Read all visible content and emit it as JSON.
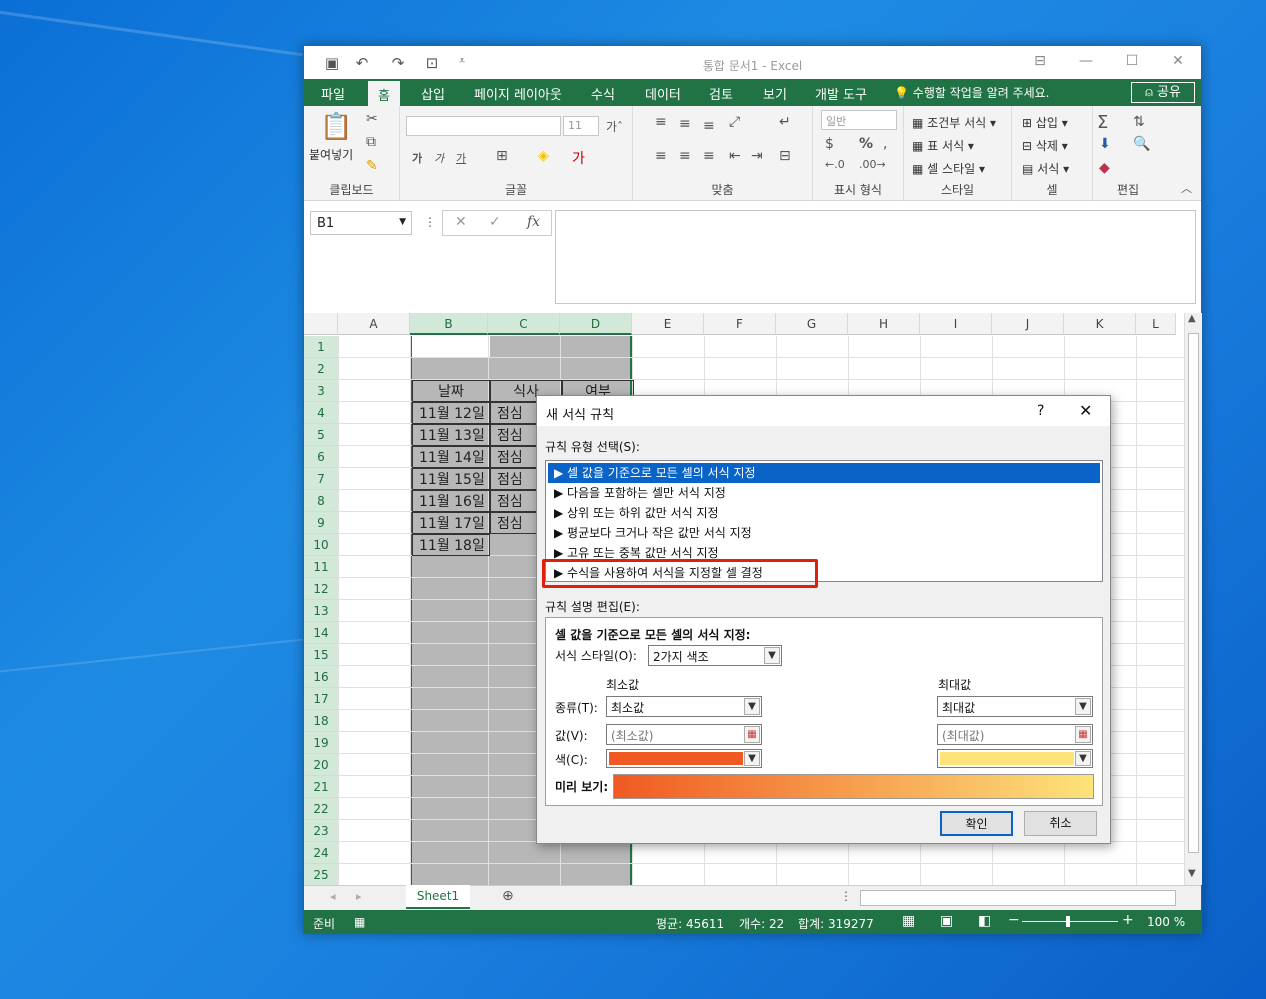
{
  "window": {
    "title": "통합 문서1 - Excel"
  },
  "tabs": [
    "파일",
    "홈",
    "삽입",
    "페이지 레이아웃",
    "수식",
    "데이터",
    "검토",
    "보기",
    "개발 도구"
  ],
  "tellme": "수행할 작업을 알려 주세요.",
  "share": "공유",
  "ribbon": {
    "clipboard": {
      "label": "클립보드",
      "paste": "붙여넣기"
    },
    "font": {
      "label": "글꼴",
      "size": "11"
    },
    "align": {
      "label": "맞춤"
    },
    "number": {
      "label": "표시 형식",
      "format": "일반"
    },
    "styles": {
      "label": "스타일",
      "cond": "조건부 서식",
      "table": "표 서식",
      "cell": "셀 스타일"
    },
    "cells": {
      "label": "셀",
      "insert": "삽입",
      "delete": "삭제",
      "format": "서식"
    },
    "edit": {
      "label": "편집"
    }
  },
  "namebox": "B1",
  "fx": "fx",
  "columns": [
    "A",
    "B",
    "C",
    "D",
    "E",
    "F",
    "G",
    "H",
    "I",
    "J",
    "K",
    "L"
  ],
  "rows": [
    "1",
    "2",
    "3",
    "4",
    "5",
    "6",
    "7",
    "8",
    "9",
    "10",
    "11",
    "12",
    "13",
    "14",
    "15",
    "16",
    "17",
    "18",
    "19",
    "20",
    "21",
    "22",
    "23",
    "24",
    "25"
  ],
  "table": {
    "headers": [
      "날짜",
      "식사",
      "여부"
    ],
    "dates": [
      "11월 12일",
      "11월 13일",
      "11월 14일",
      "11월 15일",
      "11월 16일",
      "11월 17일",
      "11월 18일"
    ],
    "meals": [
      "점심",
      "점심",
      "점심",
      "점심",
      "점심",
      "점심"
    ]
  },
  "sheet": {
    "tab": "Sheet1"
  },
  "status": {
    "ready": "준비",
    "avg": "평균: 45611",
    "count": "개수: 22",
    "sum": "합계: 319277",
    "zoom": "100 %"
  },
  "dialog": {
    "title": "새 서식 규칙",
    "help": "?",
    "select_label": "규칙 유형 선택(S):",
    "rules": [
      "셀 값을 기준으로 모든 셀의 서식 지정",
      "다음을 포함하는 셀만 서식 지정",
      "상위 또는 하위 값만 서식 지정",
      "평균보다 크거나 작은 값만 서식 지정",
      "고유 또는 중복 값만 서식 지정",
      "수식을 사용하여 서식을 지정할 셀 결정"
    ],
    "edit_label": "규칙 설명 편집(E):",
    "desc_heading": "셀 값을 기준으로 모든 셀의 서식 지정:",
    "style_label": "서식 스타일(O):",
    "style_value": "2가지 색조",
    "min_head": "최소값",
    "max_head": "최대값",
    "type_label": "종류(T):",
    "min_type": "최소값",
    "max_type": "최대값",
    "value_label": "값(V):",
    "min_value": "(최소값)",
    "max_value": "(최대값)",
    "color_label": "색(C):",
    "preview_label": "미리 보기:",
    "ok": "확인",
    "cancel": "취소",
    "min_color": "#f05a22",
    "max_color": "#fde37a"
  }
}
